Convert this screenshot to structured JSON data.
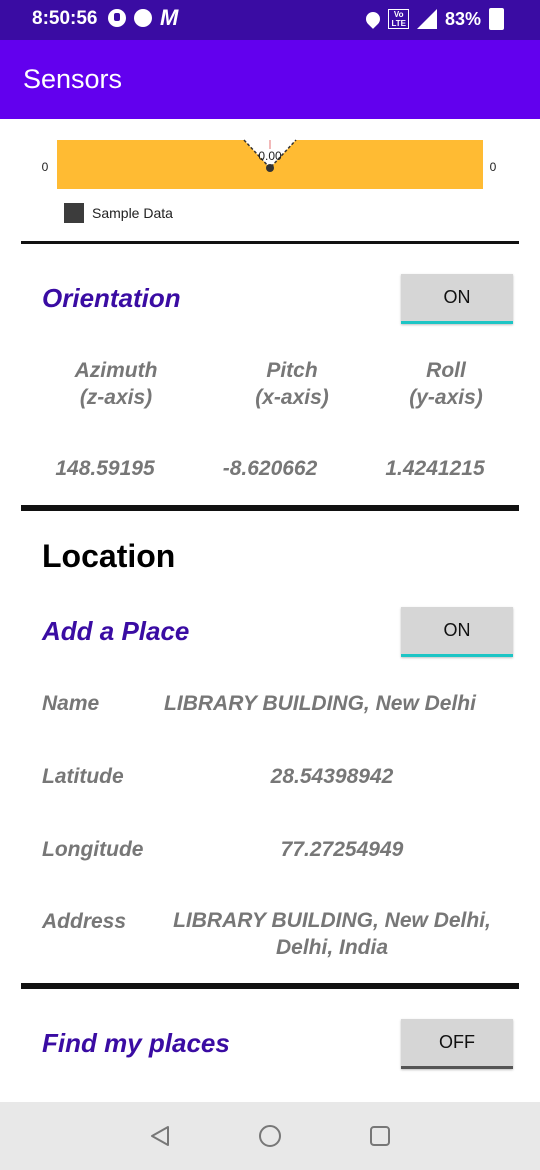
{
  "status_bar": {
    "time": "8:50:56",
    "battery": "83%",
    "icons": [
      "app-circle-icon",
      "dot-icon",
      "m-icon",
      "location-pin-icon",
      "volte-icon",
      "signal-icon",
      "battery-icon"
    ]
  },
  "app_bar": {
    "title": "Sensors"
  },
  "chart_data": {
    "type": "area",
    "left_axis_label": "0",
    "right_axis_label": "0",
    "point_label": "0.00",
    "legend": "Sample Data",
    "fill_color": "#ffbb33"
  },
  "orientation": {
    "title": "Orientation",
    "toggle": "ON",
    "headers": [
      {
        "name": "Azimuth",
        "axis": "(z-axis)"
      },
      {
        "name": "Pitch",
        "axis": "(x-axis)"
      },
      {
        "name": "Roll",
        "axis": "(y-axis)"
      }
    ],
    "values": [
      "148.59195",
      "-8.620662",
      "1.4241215"
    ]
  },
  "location": {
    "heading": "Location",
    "add_place": {
      "title": "Add a Place",
      "toggle": "ON"
    },
    "name_label": "Name",
    "name_value": "LIBRARY BUILDING, New Delhi",
    "latitude_label": "Latitude",
    "latitude_value": "28.54398942",
    "longitude_label": "Longitude",
    "longitude_value": "77.27254949",
    "address_label": "Address",
    "address_line1": "LIBRARY BUILDING, New Delhi,",
    "address_line2": "Delhi, India"
  },
  "find_places": {
    "title": "Find my places",
    "toggle": "OFF"
  },
  "nav_bar": {
    "icons": [
      "back-icon",
      "home-icon",
      "recents-icon"
    ]
  },
  "colors": {
    "status_bar": "#3a0ca3",
    "app_bar": "#6200ee",
    "accent": "#3a0ca3",
    "toggle_on_line": "#1dc5c5"
  }
}
